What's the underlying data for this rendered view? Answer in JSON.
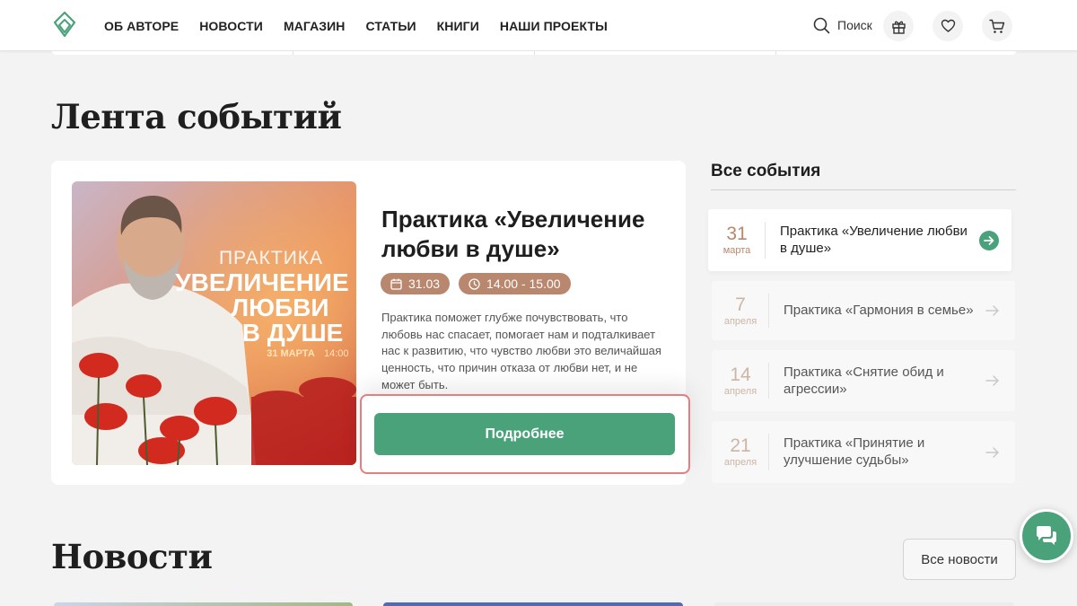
{
  "header": {
    "nav": [
      "ОБ АВТОРЕ",
      "НОВОСТИ",
      "МАГАЗИН",
      "СТАТЬИ",
      "КНИГИ",
      "НАШИ ПРОЕКТЫ"
    ],
    "search_label": "Поиск"
  },
  "colors": {
    "accent_green": "#4aa27b",
    "badge_brown": "#b8876d",
    "highlight_red": "#e57e7e"
  },
  "events_section": {
    "title": "Лента событий",
    "featured": {
      "title": "Практика «Увеличение любви в душе»",
      "date": "31.03",
      "time": "14.00 - 15.00",
      "description": "Практика поможет глубже почувствовать, что любовь нас спасает, помогает нам и подталкивает нас к развитию, что чувство любви это величайшая ценность, что причин отказа от любви нет, и не может быть.",
      "button_label": "Подробнее",
      "poster": {
        "line1": "ПРАКТИКА",
        "line2": "УВЕЛИЧЕНИЕ",
        "line3": "ЛЮБВИ",
        "line4": "В ДУШЕ",
        "date_text": "31 МАРТА",
        "time_text": "14:00"
      }
    },
    "all_events_label": "Все события",
    "list": [
      {
        "day": "31",
        "month": "марта",
        "name": "Практика «Увеличение любви в душе»",
        "active": true
      },
      {
        "day": "7",
        "month": "апреля",
        "name": "Практика «Гармония в семье»",
        "active": false
      },
      {
        "day": "14",
        "month": "апреля",
        "name": "Практика «Снятие обид и агрессии»",
        "active": false
      },
      {
        "day": "21",
        "month": "апреля",
        "name": "Практика «Принятие и улучшение судьбы»",
        "active": false
      }
    ]
  },
  "news_section": {
    "title": "Новости",
    "all_news_label": "Все новости"
  },
  "icons": {
    "logo": "leaf-logo-icon",
    "search": "search-icon",
    "gift": "gift-icon",
    "favorites": "heart-icon",
    "cart": "cart-icon",
    "calendar": "calendar-icon",
    "clock": "clock-icon",
    "arrow": "arrow-right-icon",
    "chat": "chat-icon"
  }
}
